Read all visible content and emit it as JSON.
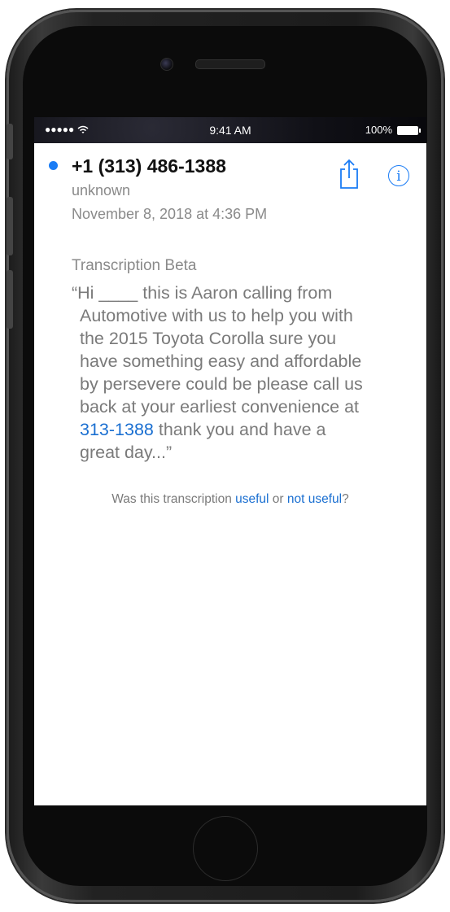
{
  "status_bar": {
    "signal": "●●●●● ",
    "wifi_icon": "wifi-icon",
    "time": "9:41 AM",
    "battery_percent": "100%",
    "battery_level": 1.0
  },
  "voicemail": {
    "caller": "+1 (313) 486-1388",
    "label": "unknown",
    "datetime": "November 8, 2018 at 4:36 PM",
    "unread_color": "#1a7cf5",
    "share_icon": "share-icon",
    "info_icon": "info-icon",
    "info_glyph": "i"
  },
  "transcription": {
    "title": "Transcription Beta",
    "lines": [
      "“Hi ____ this is Aaron calling from",
      "Automotive with us to help you with",
      "the 2015 Toyota Corolla sure you",
      "have something easy and affordable",
      "by persevere could be please call us",
      "back at your earliest convenience at"
    ],
    "phone_link": "313-1388",
    "line7_rest": " thank you and have a",
    "line8": "great day...”",
    "feedback_prefix": "Was this transcription ",
    "feedback_useful": "useful",
    "feedback_or": " or ",
    "feedback_not_useful": "not useful",
    "feedback_suffix": "?"
  },
  "colors": {
    "accent": "#1a7cf5",
    "link": "#1a6fd1"
  }
}
